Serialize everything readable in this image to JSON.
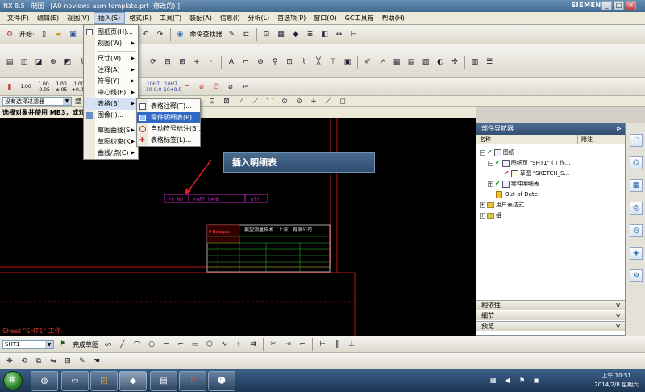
{
  "window": {
    "title": "NX 8.5 - 制图 - [A0-noviews-asm-template.prt  (修改的) ]",
    "brand": "SIEMENS",
    "controls": [
      "_",
      "□",
      "×"
    ]
  },
  "menubar": {
    "items": [
      "文件(F)",
      "编辑(E)",
      "视图(V)",
      "插入(S)",
      "格式(R)",
      "工具(T)",
      "装配(A)",
      "信息(I)",
      "分析(L)",
      "首选项(P)",
      "窗口(O)",
      "GC工具箱",
      "帮助(H)"
    ],
    "active_index": 3
  },
  "toolbar1": {
    "start_label": "开始·",
    "command_finder": "命令查找器"
  },
  "toolbar3": {
    "scales": [
      "1.00",
      "1.00\n-0.05",
      "1.00\n±.05",
      "1.00\n+0.05"
    ],
    "dims": [
      "10H7\n10-0.0",
      "10H7\n10+0.0"
    ]
  },
  "selection": {
    "filter_value": "没有选择过滤器",
    "assembly_value": "整"
  },
  "cue_line": "选择对象并使用 MB3，或双击",
  "insert_menu": {
    "items": [
      {
        "label": "图纸页(H)...",
        "has_sub": false
      },
      {
        "label": "视图(W)",
        "has_sub": true
      },
      {
        "sep": true
      },
      {
        "label": "尺寸(M)",
        "has_sub": true
      },
      {
        "label": "注释(A)",
        "has_sub": true
      },
      {
        "label": "符号(Y)",
        "has_sub": true
      },
      {
        "label": "中心线(E)",
        "has_sub": true
      },
      {
        "label": "表格(B)",
        "has_sub": true,
        "highlight": true
      },
      {
        "label": "图像(I)...",
        "has_sub": false
      },
      {
        "sep": true
      },
      {
        "label": "草图曲线(S)",
        "has_sub": true
      },
      {
        "label": "草图约束(K)",
        "has_sub": true
      },
      {
        "label": "曲线/点(C)",
        "has_sub": true
      }
    ]
  },
  "table_submenu": {
    "items": [
      {
        "label": "表格注释(T)..."
      },
      {
        "label": "零件明细表(P)...",
        "highlight": true
      },
      {
        "label": "自动符号标注(B)..."
      },
      {
        "label": "表格标签(L)..."
      }
    ]
  },
  "callout": "插入明细表",
  "drawing": {
    "header_cells": [
      "PC NO",
      "PART NAME",
      "QTY"
    ],
    "company": "展望测量技术（上海）有限公司",
    "logo": "F·Hexagon"
  },
  "sheet_label": "Sheet \"SHT1\" 工作",
  "part_navigator": {
    "title": "部件导航器",
    "columns": [
      "名称",
      "附注"
    ],
    "rows": [
      {
        "label": "图纸",
        "level": 0,
        "expander": "-",
        "check": true,
        "indent": 4
      },
      {
        "label": "图纸页 \"SHT1\" (工作...",
        "level": 1,
        "expander": "-",
        "check": true,
        "indent": 14
      },
      {
        "label": "草图 \"SKETCH_S...",
        "level": 2,
        "expander": "",
        "check": true,
        "indent": 28
      },
      {
        "label": "零件明细表",
        "level": 1,
        "expander": "+",
        "check": true,
        "indent": 14
      },
      {
        "label": "Out-of-Date",
        "level": 1,
        "expander": "",
        "check": false,
        "indent": 22
      },
      {
        "label": "用户表达式",
        "level": 0,
        "expander": "+",
        "check": false,
        "indent": 4
      },
      {
        "label": "组",
        "level": 0,
        "expander": "+",
        "check": false,
        "indent": 4
      }
    ],
    "sections": [
      "相依性",
      "细节",
      "预览"
    ]
  },
  "bottom_toolbar": {
    "sheet_combo": "SHT1",
    "finish_sketch": "完成草图"
  },
  "taskbar": {
    "time": "上午 10:51",
    "date": "2014/2/8 星期六",
    "apps": [
      "explorer",
      "folder",
      "office",
      "nx",
      "notepad",
      "powerpoint",
      "qq"
    ]
  }
}
